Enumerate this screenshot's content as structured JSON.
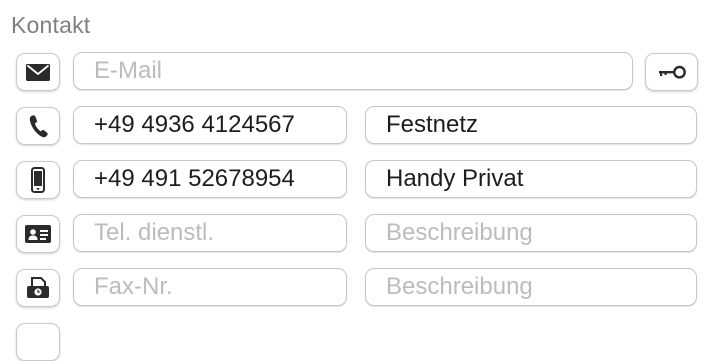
{
  "section": {
    "title": "Kontakt"
  },
  "email": {
    "icon": "envelope-icon",
    "placeholder": "E-Mail",
    "value": "",
    "action_icon": "key-icon"
  },
  "phones": [
    {
      "icon": "phone-icon",
      "number": "+49 4936 4124567",
      "number_placeholder": "",
      "description": "Festnetz",
      "description_placeholder": ""
    },
    {
      "icon": "mobile-phone-icon",
      "number": "+49 491 52678954",
      "number_placeholder": "",
      "description": "Handy Privat",
      "description_placeholder": ""
    },
    {
      "icon": "business-card-icon",
      "number": "",
      "number_placeholder": "Tel. dienstl.",
      "description": "",
      "description_placeholder": "Beschreibung"
    },
    {
      "icon": "fax-icon",
      "number": "",
      "number_placeholder": "Fax-Nr.",
      "description": "",
      "description_placeholder": "Beschreibung"
    }
  ],
  "colors": {
    "label": "#808080",
    "text": "#1d1d1d",
    "placeholder": "#bcbcbc",
    "border": "#c6c6c6",
    "icon": "#2b2b2b"
  }
}
